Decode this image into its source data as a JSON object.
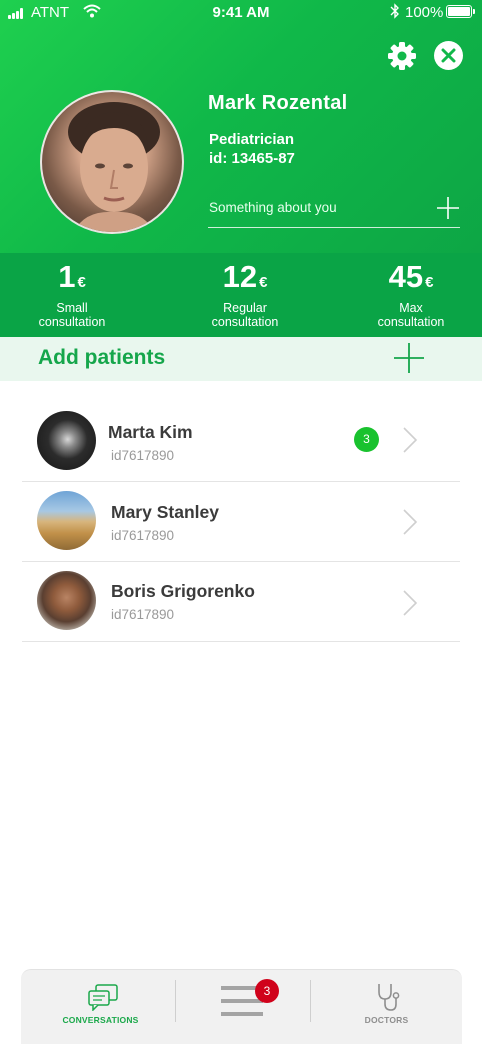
{
  "status_bar": {
    "carrier": "ATNT",
    "time": "9:41 AM",
    "battery": "100%"
  },
  "profile": {
    "name": "Mark Rozental",
    "specialty": "Pediatrician",
    "id": "id: 13465-87",
    "about_placeholder": "Something about you"
  },
  "prices": [
    {
      "amount": "1",
      "currency": "€",
      "label_line1": "Small",
      "label_line2": "consultation"
    },
    {
      "amount": "12",
      "currency": "€",
      "label_line1": "Regular",
      "label_line2": "consultation"
    },
    {
      "amount": "45",
      "currency": "€",
      "label_line1": "Max",
      "label_line2": "consultation"
    }
  ],
  "add_patients": {
    "title": "Add patients"
  },
  "patients": [
    {
      "name": "Marta Kim",
      "id": "id7617890",
      "unread": "3"
    },
    {
      "name": "Mary Stanley",
      "id": "id7617890"
    },
    {
      "name": "Boris Grigorenko",
      "id": "id7617890"
    }
  ],
  "tabbar": {
    "conversations_label": "CONVERSATIONS",
    "menu_badge": "3",
    "doctors_label": "DOCTORS",
    "active_color": "#1aa84a",
    "inactive_color": "#8e8e8e"
  },
  "colors": {
    "brand_green": "#10b849",
    "price_bar": "#0aa446",
    "add_bar_bg": "#e9f7ee",
    "badge_green": "#19c22e",
    "badge_red": "#d0021b"
  }
}
